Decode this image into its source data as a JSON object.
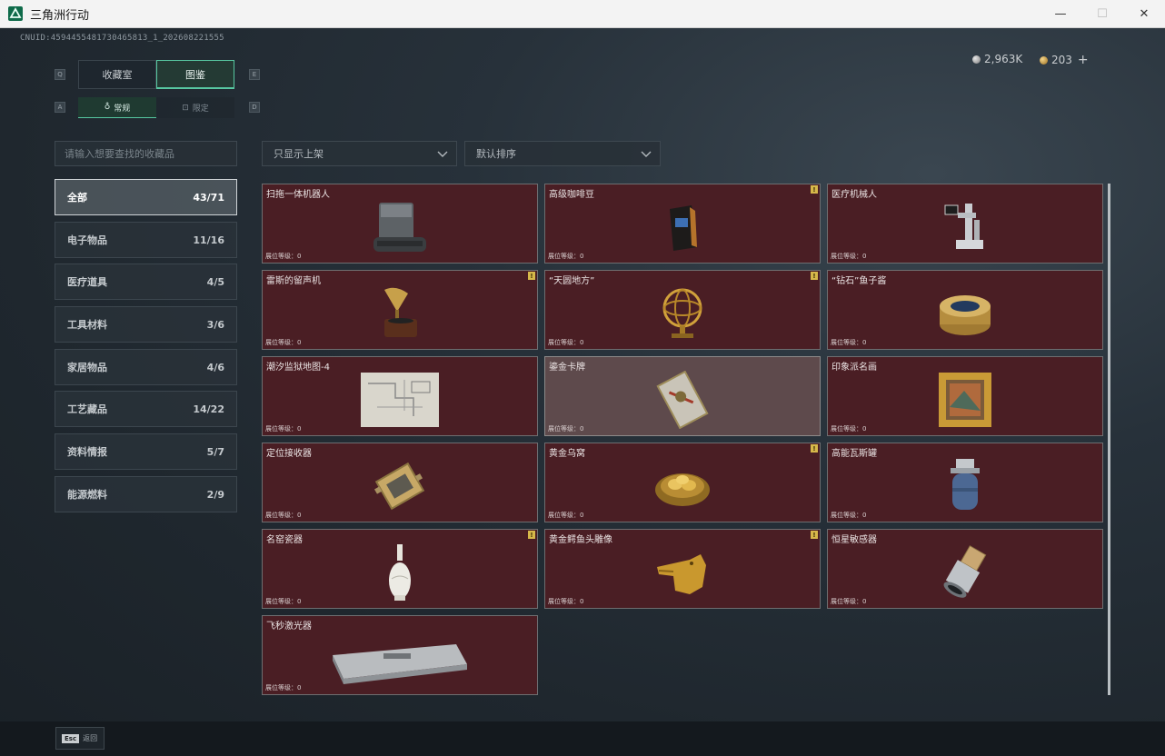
{
  "window": {
    "title": "三角洲行动",
    "minimize": "—",
    "maximize": "☐",
    "close": "✕"
  },
  "uid": "CNUID:4594455481730465813_1_202608221555",
  "currency": {
    "silver": "2,963K",
    "gold": "203",
    "plus": "+"
  },
  "tabs_main": {
    "left_key": "Q",
    "right_key": "E",
    "items": [
      {
        "label": "收藏室"
      },
      {
        "label": "图鉴"
      }
    ]
  },
  "tabs_sub": {
    "left_key": "A",
    "right_key": "D",
    "items": [
      {
        "label": "常规",
        "icon": "♁"
      },
      {
        "label": "限定",
        "icon": "⊡"
      }
    ]
  },
  "search": {
    "placeholder": "请输入想要查找的收藏品"
  },
  "filters": {
    "shelf": "只显示上架",
    "sort": "默认排序"
  },
  "categories": [
    {
      "label": "全部",
      "count": "43/71"
    },
    {
      "label": "电子物品",
      "count": "11/16"
    },
    {
      "label": "医疗道具",
      "count": "4/5"
    },
    {
      "label": "工具材料",
      "count": "3/6"
    },
    {
      "label": "家居物品",
      "count": "4/6"
    },
    {
      "label": "工艺藏品",
      "count": "14/22"
    },
    {
      "label": "资料情报",
      "count": "5/7"
    },
    {
      "label": "能源燃料",
      "count": "2/9"
    }
  ],
  "level_label": "展位等级：0",
  "flag_mark": "!",
  "items": [
    {
      "name": "扫拖一体机器人",
      "icon": "robot-vacuum-icon",
      "flag": false
    },
    {
      "name": "高级咖啡豆",
      "icon": "coffee-bag-icon",
      "flag": true
    },
    {
      "name": "医疗机械人",
      "icon": "medical-robot-icon",
      "flag": false
    },
    {
      "name": "雷斯的留声机",
      "icon": "gramophone-icon",
      "flag": true
    },
    {
      "name": "“天圆地方”",
      "icon": "armillary-sphere-icon",
      "flag": true
    },
    {
      "name": "“钻石”鱼子酱",
      "icon": "caviar-tin-icon",
      "flag": false
    },
    {
      "name": "潮汐监狱地图-4",
      "icon": "map-icon",
      "flag": false
    },
    {
      "name": "鎏金卡牌",
      "icon": "card-icon",
      "flag": false
    },
    {
      "name": "印象派名画",
      "icon": "painting-icon",
      "flag": false
    },
    {
      "name": "定位接收器",
      "icon": "receiver-icon",
      "flag": false
    },
    {
      "name": "黄金乌窝",
      "icon": "golden-nest-icon",
      "flag": true
    },
    {
      "name": "高能瓦斯罐",
      "icon": "gas-tank-icon",
      "flag": false
    },
    {
      "name": "名窑瓷器",
      "icon": "porcelain-vase-icon",
      "flag": true
    },
    {
      "name": "黄金鳄鱼头雕像",
      "icon": "gold-croc-icon",
      "flag": true
    },
    {
      "name": "恒星敏感器",
      "icon": "star-sensor-icon",
      "flag": false
    },
    {
      "name": "飞秒激光器",
      "icon": "laser-case-icon",
      "flag": false
    }
  ],
  "bottom": {
    "esc_key": "Esc",
    "back_label": "返回"
  }
}
